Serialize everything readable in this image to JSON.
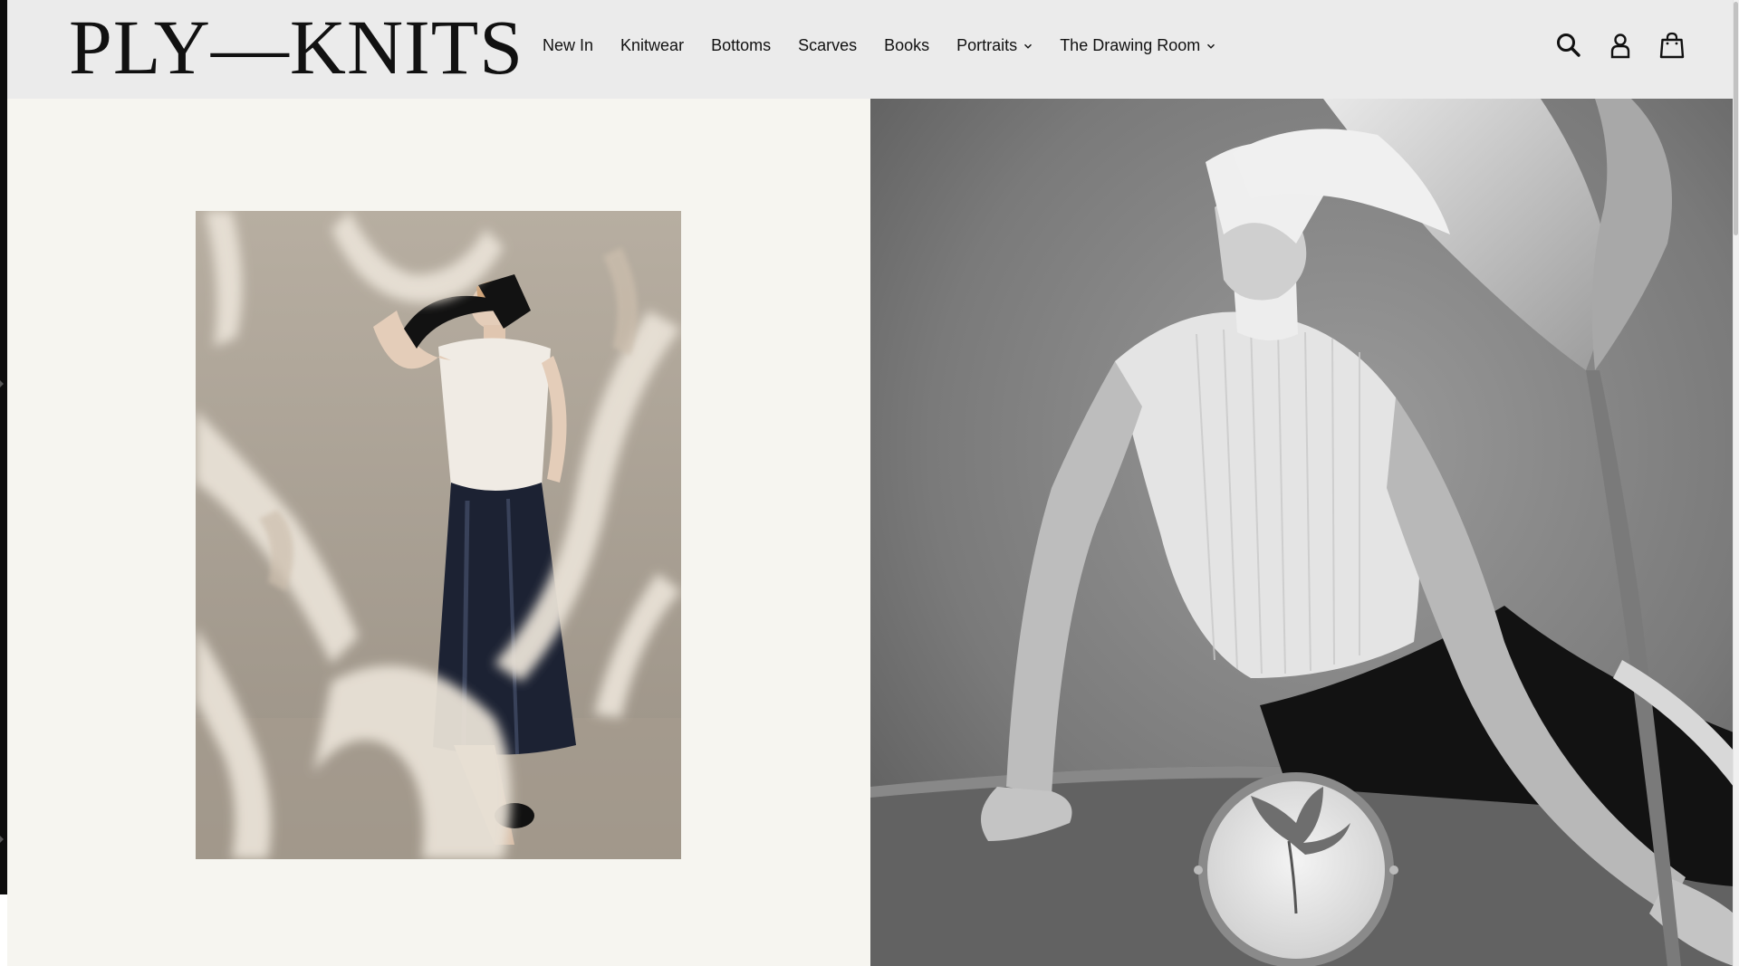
{
  "brand": {
    "logo_text": "PLY—KNITS"
  },
  "nav": {
    "items": [
      {
        "label": "New In",
        "dropdown": false
      },
      {
        "label": "Knitwear",
        "dropdown": false
      },
      {
        "label": "Bottoms",
        "dropdown": false
      },
      {
        "label": "Scarves",
        "dropdown": false
      },
      {
        "label": "Books",
        "dropdown": false
      },
      {
        "label": "Portraits",
        "dropdown": true
      },
      {
        "label": "The Drawing Room",
        "dropdown": true
      }
    ]
  },
  "header_icons": [
    "search-icon",
    "account-icon",
    "cart-icon"
  ],
  "colors": {
    "header_bg": "#ebebeb",
    "page_bg": "#f6f5f0",
    "text": "#111111"
  },
  "hero": {
    "left_image": "model-behind-blurred-branches-color-photo",
    "right_image": "model-with-lily-black-and-white-photo"
  }
}
